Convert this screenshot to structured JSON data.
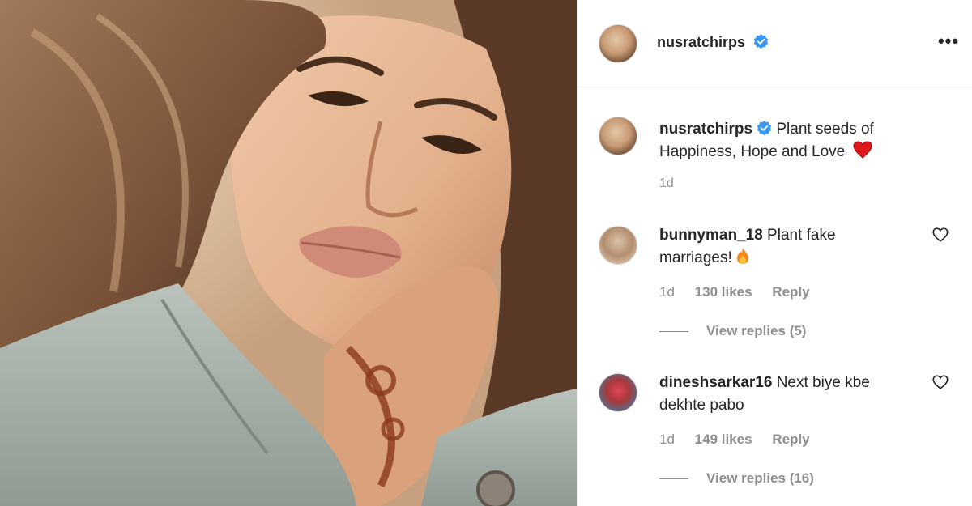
{
  "post": {
    "image_icon": "portrait-photo",
    "author": {
      "username": "nusratchirps",
      "verified_icon": "verified-badge-icon",
      "more_options_glyph": "•••"
    },
    "caption": {
      "username": "nusratchirps",
      "text": "Plant seeds of Happiness, Hope and Love",
      "emoji_icon": "red-heart-emoji",
      "time": "1d"
    },
    "comments": [
      {
        "username": "bunnyman_18",
        "text": "Plant fake marriages!",
        "emoji_icon": "fire-emoji",
        "time": "1d",
        "likes": "130 likes",
        "reply_label": "Reply",
        "view_replies": "View replies (5)",
        "like_icon": "heart-outline-icon"
      },
      {
        "username": "dineshsarkar16",
        "text": "Next biye kbe dekhte pabo",
        "time": "1d",
        "likes": "149 likes",
        "reply_label": "Reply",
        "view_replies": "View replies (16)",
        "like_icon": "heart-outline-icon"
      }
    ]
  },
  "colors": {
    "text": "#262626",
    "secondary_text": "#8e8e8e",
    "verified_blue": "#3897f0",
    "divider": "#efefef",
    "heart_red": "#e0161d"
  }
}
